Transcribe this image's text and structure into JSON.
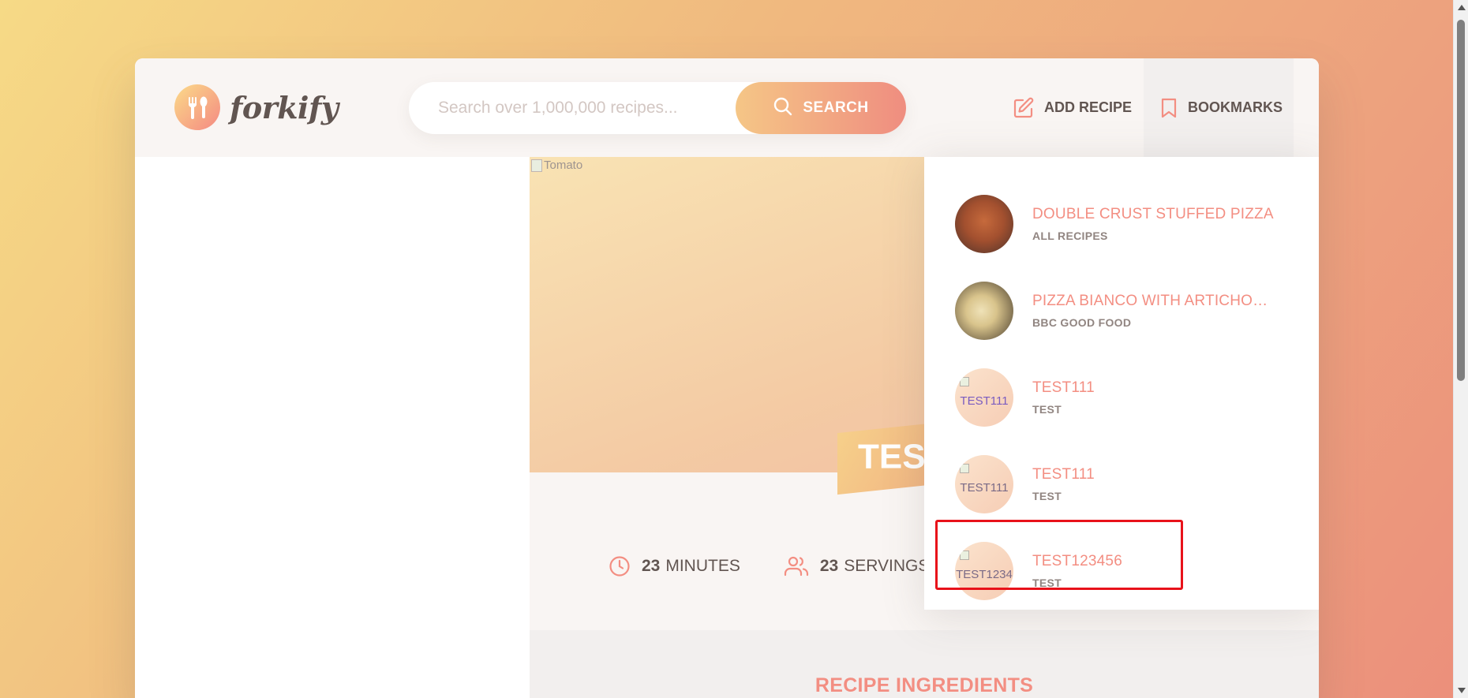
{
  "header": {
    "logo_text": "forkify",
    "search": {
      "placeholder": "Search over 1,000,000 recipes...",
      "value": ""
    },
    "search_button_label": "SEARCH",
    "add_recipe_label": "ADD RECIPE",
    "bookmarks_label": "BOOKMARKS"
  },
  "recipe": {
    "image_alt": "Tomato",
    "title": "TEST",
    "cooking_time": "23",
    "cooking_time_unit": "MINUTES",
    "servings": "23",
    "servings_unit": "SERVINGS",
    "ingredients_heading": "RECIPE INGREDIENTS"
  },
  "bookmarks": [
    {
      "title": "DOUBLE CRUST STUFFED PIZZA",
      "publisher": "ALL RECIPES",
      "thumb": ""
    },
    {
      "title": "PIZZA BIANCO WITH ARTICHOKE ...",
      "publisher": "BBC GOOD FOOD",
      "thumb": ""
    },
    {
      "title": "TEST111",
      "publisher": "TEST",
      "thumb": "TEST111"
    },
    {
      "title": "TEST111",
      "publisher": "TEST",
      "thumb": "TEST111"
    },
    {
      "title": "TEST123456",
      "publisher": "TEST",
      "thumb": "TEST1234"
    }
  ],
  "colors": {
    "accent": "#f38e82",
    "text": "#615551",
    "highlight": "#e8121a"
  },
  "icons": {
    "logo": "fork-spoon-icon",
    "search": "search-icon",
    "add_recipe": "edit-icon",
    "bookmarks": "bookmark-icon",
    "time": "clock-icon",
    "servings": "users-icon"
  }
}
